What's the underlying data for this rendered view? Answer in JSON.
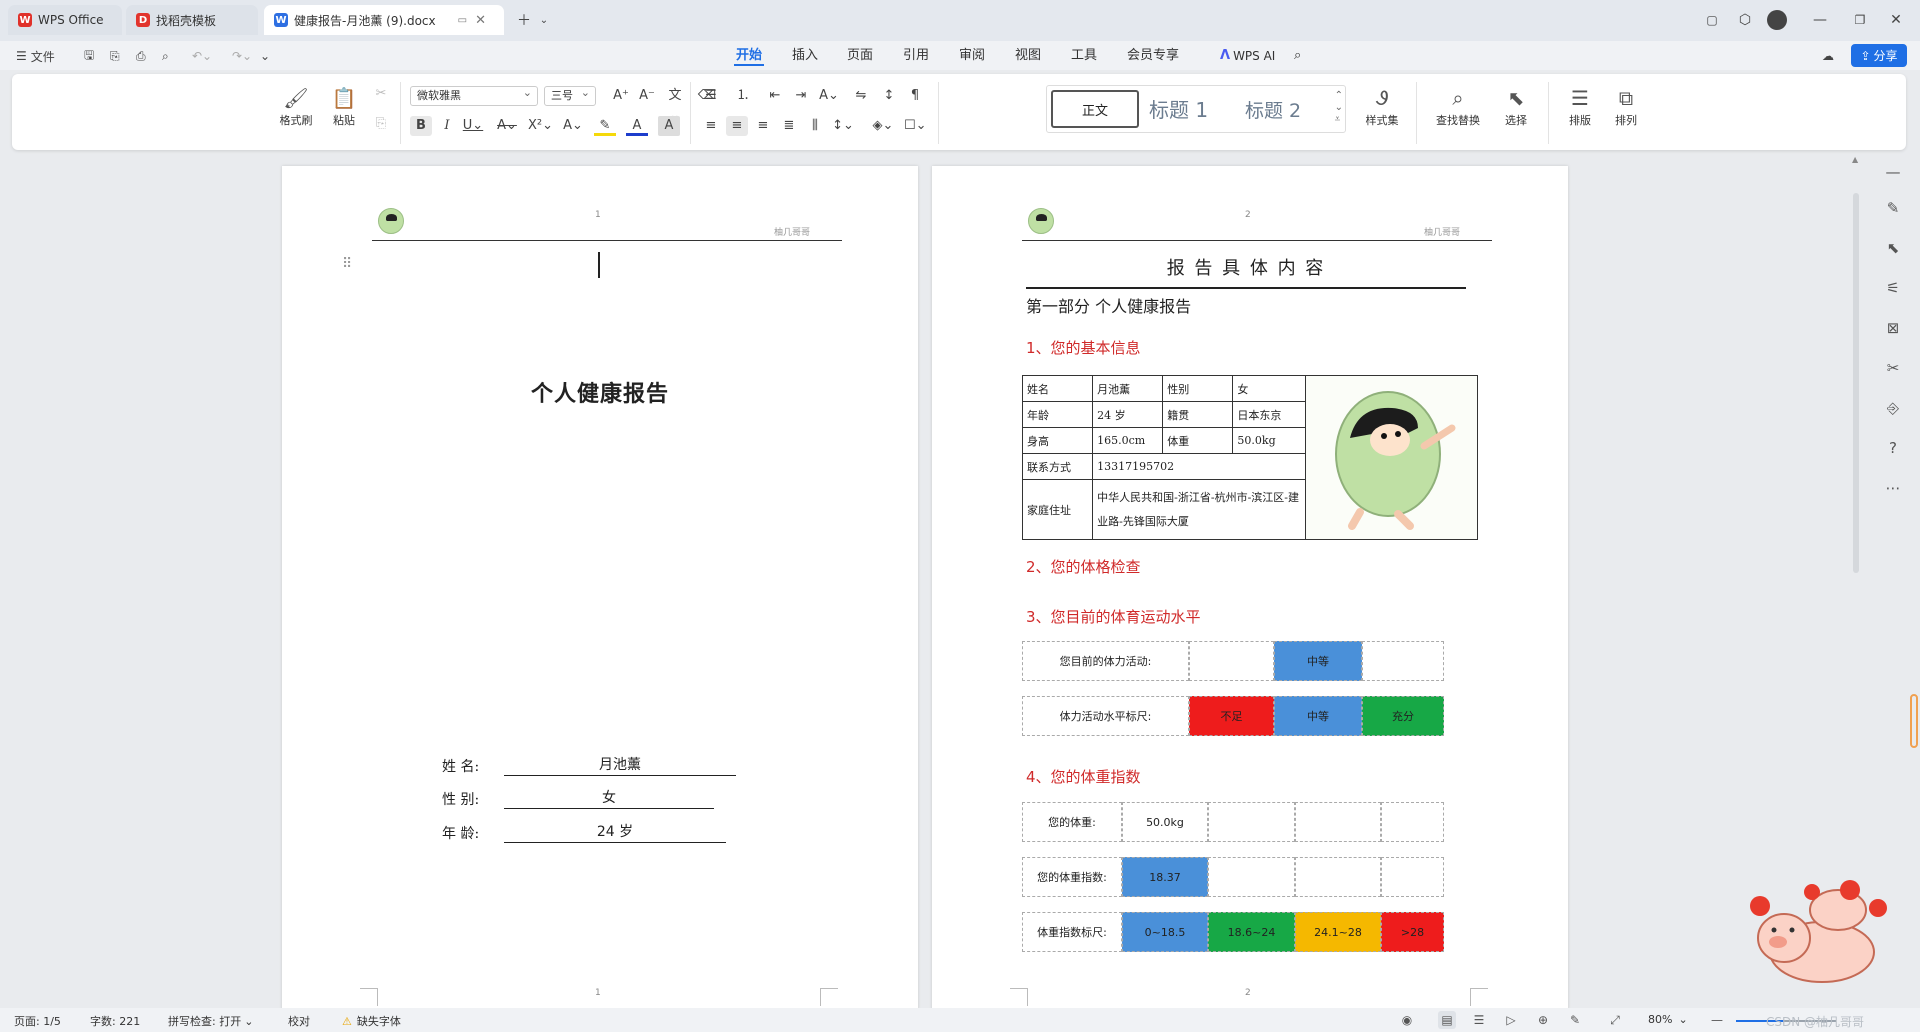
{
  "tabs": [
    {
      "label": "WPS Office",
      "icon": "wps-logo-icon",
      "color": "#e0312a"
    },
    {
      "label": "找稻壳模板",
      "icon": "docer-icon",
      "color": "#e2342d"
    },
    {
      "label": "健康报告-月池薰 (9).docx",
      "icon": "word-doc-icon",
      "color": "#2e6fe2"
    }
  ],
  "menubar": {
    "file": "文件",
    "items": [
      "开始",
      "插入",
      "页面",
      "引用",
      "审阅",
      "视图",
      "工具",
      "会员专享"
    ],
    "active": "开始",
    "wps_ai": "WPS AI",
    "share": "分享"
  },
  "ribbon": {
    "format_painter": "格式刷",
    "paste": "粘贴",
    "font_name": "微软雅黑",
    "font_size": "三号",
    "styles": [
      "正文",
      "标题 1",
      "标题 2"
    ],
    "style_set": "样式集",
    "find_replace": "查找替换",
    "select": "选择",
    "layout": "排版",
    "arrange": "排列",
    "colors": {
      "highlight": "#f5d90a",
      "font": "#1d3dcc",
      "accent": "#1f6fe5"
    }
  },
  "page1": {
    "page_number": "1",
    "header_text": "柚几哥哥",
    "title": "个人健康报告",
    "fields": [
      {
        "label": "姓    名:",
        "value": "月池薰"
      },
      {
        "label": "性    别:",
        "value": "女"
      },
      {
        "label": "年    龄:",
        "value": "24 岁"
      }
    ],
    "footer_number": "1"
  },
  "page2": {
    "page_number": "2",
    "header_text": "柚几哥哥",
    "title": "报 告 具 体 内 容",
    "part": "第一部分  个人健康报告",
    "section1": "1、您的基本信息",
    "info": {
      "name_label": "姓名",
      "name": "月池薰",
      "gender_label": "性别",
      "gender": "女",
      "age_label": "年龄",
      "age": "24 岁",
      "origin_label": "籍贯",
      "origin": "日本东京",
      "height_label": "身高",
      "height": "165.0cm",
      "weight_label": "体重",
      "weight": "50.0kg",
      "contact_label": "联系方式",
      "contact": "13317195702",
      "address_label": "家庭住址",
      "address": "中华人民共和国-浙江省-杭州市-滨江区-建业路-先锋国际大厦"
    },
    "section2": "2、您的体格检查",
    "section3": "3、您目前的体育运动水平",
    "activity": {
      "label": "您目前的体力活动:",
      "value": "中等",
      "scale_label": "体力活动水平标尺:",
      "scale": [
        {
          "text": "不足",
          "color": "#ee1c1c"
        },
        {
          "text": "中等",
          "color": "#4a90d9"
        },
        {
          "text": "充分",
          "color": "#17a846"
        }
      ]
    },
    "section4": "4、您的体重指数",
    "bmi": {
      "weight_label": "您的体重:",
      "weight_value": "50.0kg",
      "bmi_label": "您的体重指数:",
      "bmi_value": "18.37",
      "scale_label": "体重指数标尺:",
      "scale": [
        {
          "text": "0~18.5",
          "color": "#4a90d9"
        },
        {
          "text": "18.6~24",
          "color": "#17a846"
        },
        {
          "text": "24.1~28",
          "color": "#f5b800"
        },
        {
          "text": ">28",
          "color": "#ee1c1c"
        }
      ]
    },
    "footer_number": "2"
  },
  "status": {
    "page": "页面: 1/5",
    "words": "字数: 221",
    "spell": "拼写检查: 打开",
    "proof": "校对",
    "missing_font": "缺失字体",
    "zoom": "80%",
    "watermark": "CSDN @柚几哥哥"
  }
}
